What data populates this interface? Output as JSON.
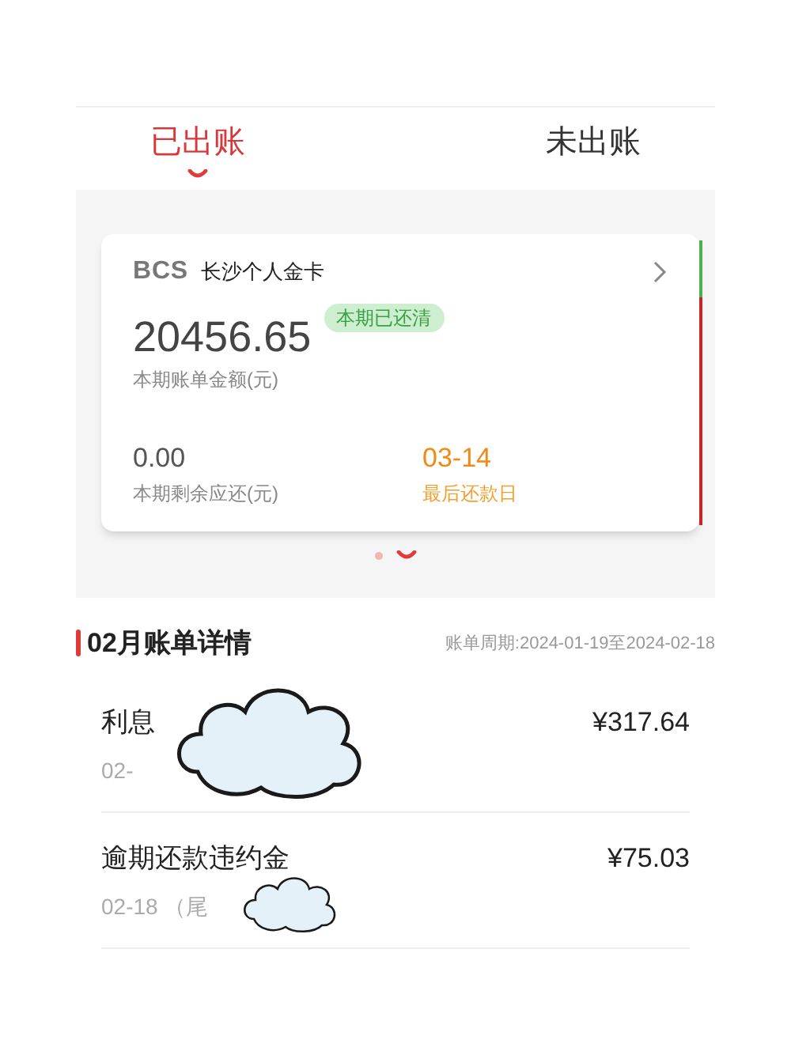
{
  "tabs": [
    {
      "label": "已出账",
      "selected": true
    },
    {
      "label": "未出账",
      "selected": false
    }
  ],
  "card": {
    "logo": "BCS",
    "name": "长沙个人金卡",
    "amount": "20456.65",
    "status": "本期已还清",
    "amount_label": "本期账单金额(元)",
    "remaining": "0.00",
    "remaining_label": "本期剩余应还(元)",
    "due_date": "03-14",
    "due_label": "最后还款日"
  },
  "pager": [
    {
      "selected": false
    },
    {
      "selected": true
    }
  ],
  "details": {
    "title": "02月账单详情",
    "period": "账单周期:2024-01-19至2024-02-18",
    "items": [
      {
        "name": "利息",
        "date": "02-",
        "amount": "¥317.64",
        "kind": "large"
      },
      {
        "name": "逾期还款违约金",
        "date": "02-18 （尾",
        "amount": "¥75.03",
        "kind": "small"
      }
    ]
  }
}
